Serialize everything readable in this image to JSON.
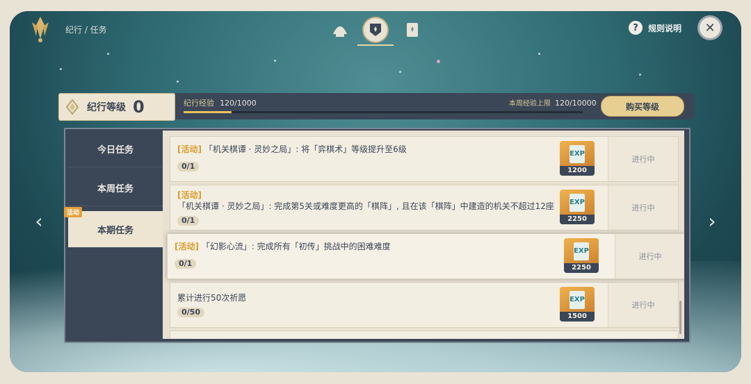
{
  "header": {
    "breadcrumb": "纪行 / 任务",
    "help_label": "规则说明",
    "tabs": [
      {
        "icon": "shell-icon",
        "active": false
      },
      {
        "icon": "badge-icon",
        "active": true
      },
      {
        "icon": "card-icon",
        "active": false
      }
    ]
  },
  "level": {
    "label": "纪行等级",
    "value": "0",
    "exp_label": "纪行经验",
    "exp_value": "120/1000",
    "exp_progress": 0.12,
    "weekly_label": "本周经验上限",
    "weekly_value": "120/10000",
    "buy_label": "购买等级"
  },
  "sidebar": {
    "items": [
      {
        "label": "今日任务",
        "active": false
      },
      {
        "label": "本周任务",
        "active": false
      },
      {
        "label": "本期任务",
        "active": true,
        "badge": "活动"
      }
    ]
  },
  "tasks": [
    {
      "tag": "[活动]",
      "text": "「机关棋谭 · 灵妙之局」: 将「弈棋术」等级提升至6级",
      "progress": "0/1",
      "reward": "1200",
      "status": "进行中"
    },
    {
      "tag": "[活动]",
      "text": "「机关棋谭 · 灵妙之局」: 完成第5关或难度更高的「棋阵」, 且在该「棋阵」中建造的机关不超过12座",
      "progress": "0/1",
      "reward": "2250",
      "status": "进行中"
    },
    {
      "tag": "[活动]",
      "text": "「幻影心流」: 完成所有「初传」挑战中的困难难度",
      "progress": "0/1",
      "reward": "2250",
      "status": "进行中"
    },
    {
      "tag": "",
      "text": "累计进行50次祈愿",
      "progress": "0/50",
      "reward": "1500",
      "status": "进行中"
    }
  ],
  "colors": {
    "accent": "#e4a23b",
    "panel": "#3b4657",
    "card": "#f3eee2"
  }
}
